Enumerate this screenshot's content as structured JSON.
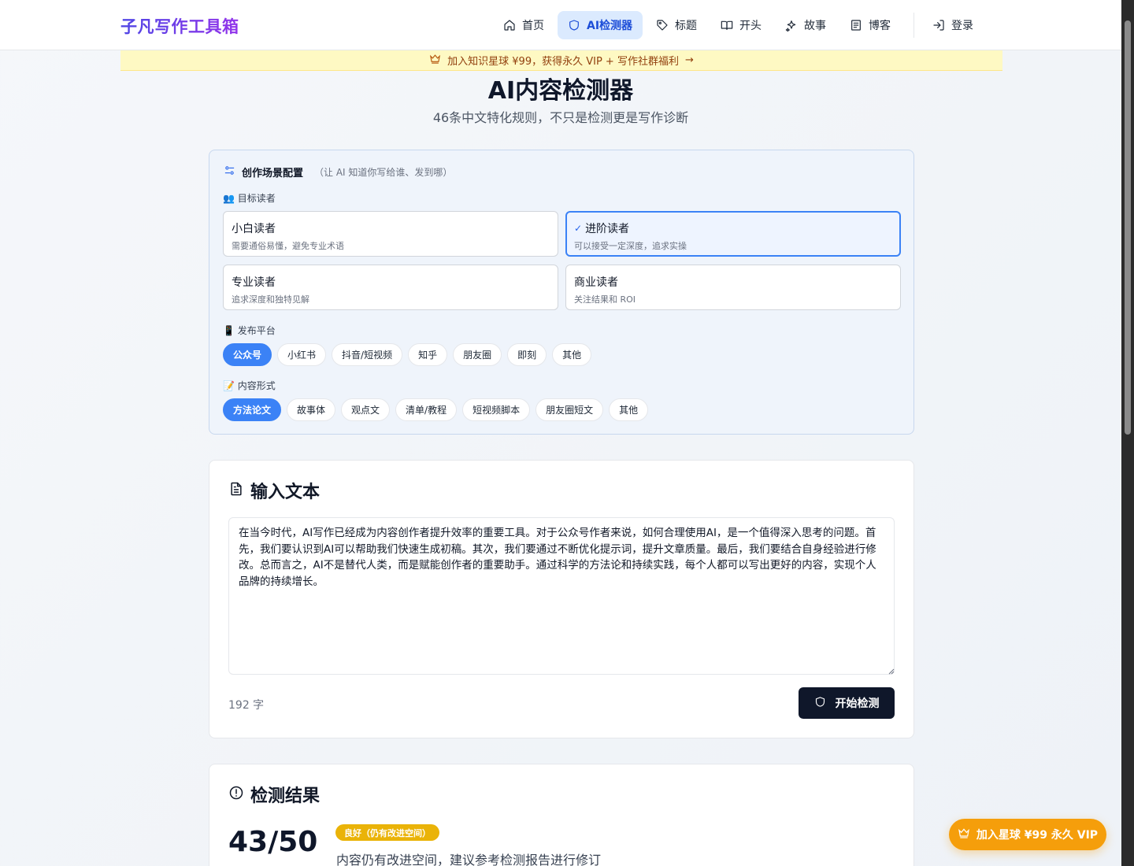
{
  "header": {
    "brand": "子凡写作工具箱",
    "nav": [
      {
        "label": "首页",
        "icon": "home-icon",
        "active": false
      },
      {
        "label": "AI检测器",
        "icon": "shield-icon",
        "active": true
      },
      {
        "label": "标题",
        "icon": "tag-icon",
        "active": false
      },
      {
        "label": "开头",
        "icon": "book-icon",
        "active": false
      },
      {
        "label": "故事",
        "icon": "sparkles-icon",
        "active": false
      },
      {
        "label": "博客",
        "icon": "newspaper-icon",
        "active": false
      }
    ],
    "login_label": "登录"
  },
  "banner": {
    "text": "加入知识星球 ¥99，获得永久 VIP + 写作社群福利",
    "arrow": "→"
  },
  "page": {
    "title": "AI内容检测器",
    "subtitle": "46条中文特化规则，不只是检测更是写作诊断"
  },
  "scene": {
    "title": "创作场景配置",
    "hint": "（让 AI 知道你写给谁、发到哪）",
    "audience_label": "👥 目标读者",
    "audiences": [
      {
        "name": "小白读者",
        "desc": "需要通俗易懂，避免专业术语",
        "selected": false
      },
      {
        "name": "进阶读者",
        "desc": "可以接受一定深度，追求实操",
        "selected": true
      },
      {
        "name": "专业读者",
        "desc": "追求深度和独特见解",
        "selected": false
      },
      {
        "name": "商业读者",
        "desc": "关注结果和 ROI",
        "selected": false
      }
    ],
    "check": "✓",
    "platform_label": "📱 发布平台",
    "platforms": [
      "公众号",
      "小红书",
      "抖音/短视频",
      "知乎",
      "朋友圈",
      "即刻",
      "其他"
    ],
    "platform_selected": 0,
    "format_label": "📝 内容形式",
    "formats": [
      "方法论文",
      "故事体",
      "观点文",
      "清单/教程",
      "短视频脚本",
      "朋友圈短文",
      "其他"
    ],
    "format_selected": 0
  },
  "input": {
    "title": "输入文本",
    "text": "在当今时代，AI写作已经成为内容创作者提升效率的重要工具。对于公众号作者来说，如何合理使用AI，是一个值得深入思考的问题。首先，我们要认识到AI可以帮助我们快速生成初稿。其次，我们要通过不断优化提示词，提升文章质量。最后，我们要结合自身经验进行修改。总而言之，AI不是替代人类，而是赋能创作者的重要助手。通过科学的方法论和持续实践，每个人都可以写出更好的内容，实现个人品牌的持续增长。",
    "char_count": "192 字",
    "button_label": "开始检测"
  },
  "result": {
    "title": "检测结果",
    "score": "43/50",
    "badge": "良好（仍有改进空间）",
    "desc": "内容仍有改进空间，建议参考检测报告进行修订"
  },
  "vip_float": {
    "label": "加入星球 ¥99 永久 VIP"
  },
  "colors": {
    "accent": "#3b82f6",
    "brand_start": "#4f46e5",
    "brand_end": "#9333ea",
    "badge": "#eab308",
    "vip": "#f59e0b",
    "dark_button": "#0f172a"
  }
}
